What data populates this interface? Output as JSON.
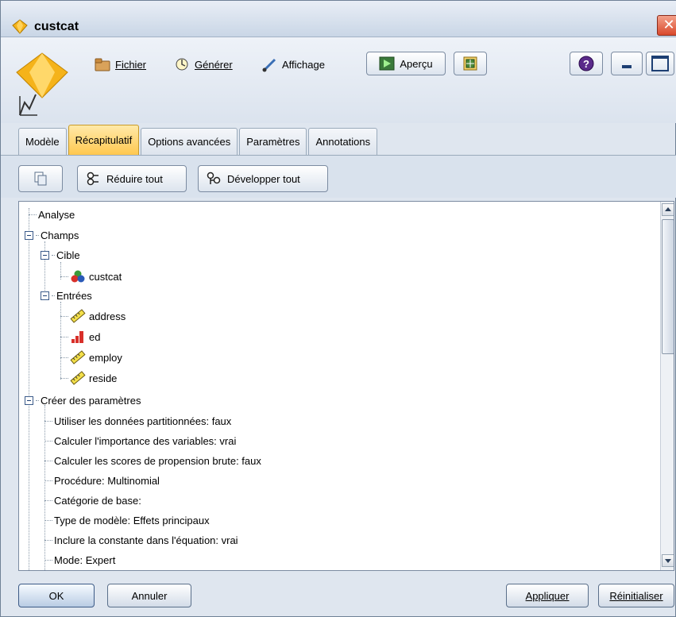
{
  "window": {
    "title": "custcat",
    "close_symbol": "✕"
  },
  "toolbar": {
    "file_label": "Fichier",
    "generate_label": "Générer",
    "view_label": "Affichage",
    "preview_label": "Aperçu"
  },
  "tabs": [
    {
      "label": "Modèle"
    },
    {
      "label": "Récapitulatif",
      "active": true
    },
    {
      "label": "Options avancées"
    },
    {
      "label": "Paramètres"
    },
    {
      "label": "Annotations"
    }
  ],
  "subbar": {
    "collapse_label": "Réduire tout",
    "expand_label": "Développer tout"
  },
  "tree": {
    "analysis": "Analyse",
    "fields": "Champs",
    "target": "Cible",
    "target_field": "custcat",
    "inputs": "Entrées",
    "input_fields": [
      "address",
      "ed",
      "employ",
      "reside"
    ],
    "build_settings": "Créer des paramètres",
    "settings": [
      "Utiliser les données partitionnées: faux",
      "Calculer l'importance des variables: vrai",
      "Calculer les scores de propension brute: faux",
      "Procédure: Multinomial",
      "Catégorie de base:",
      "Type de modèle: Effets principaux",
      "Inclure la constante dans l'équation: vrai",
      "Mode: Expert"
    ]
  },
  "buttons": {
    "ok": "OK",
    "cancel": "Annuler",
    "apply": "Appliquer",
    "reset": "Réinitialiser"
  },
  "colors": {
    "active_tab": "#ffc850",
    "window_bg": "#dfe6ef",
    "close": "#d9492c"
  }
}
